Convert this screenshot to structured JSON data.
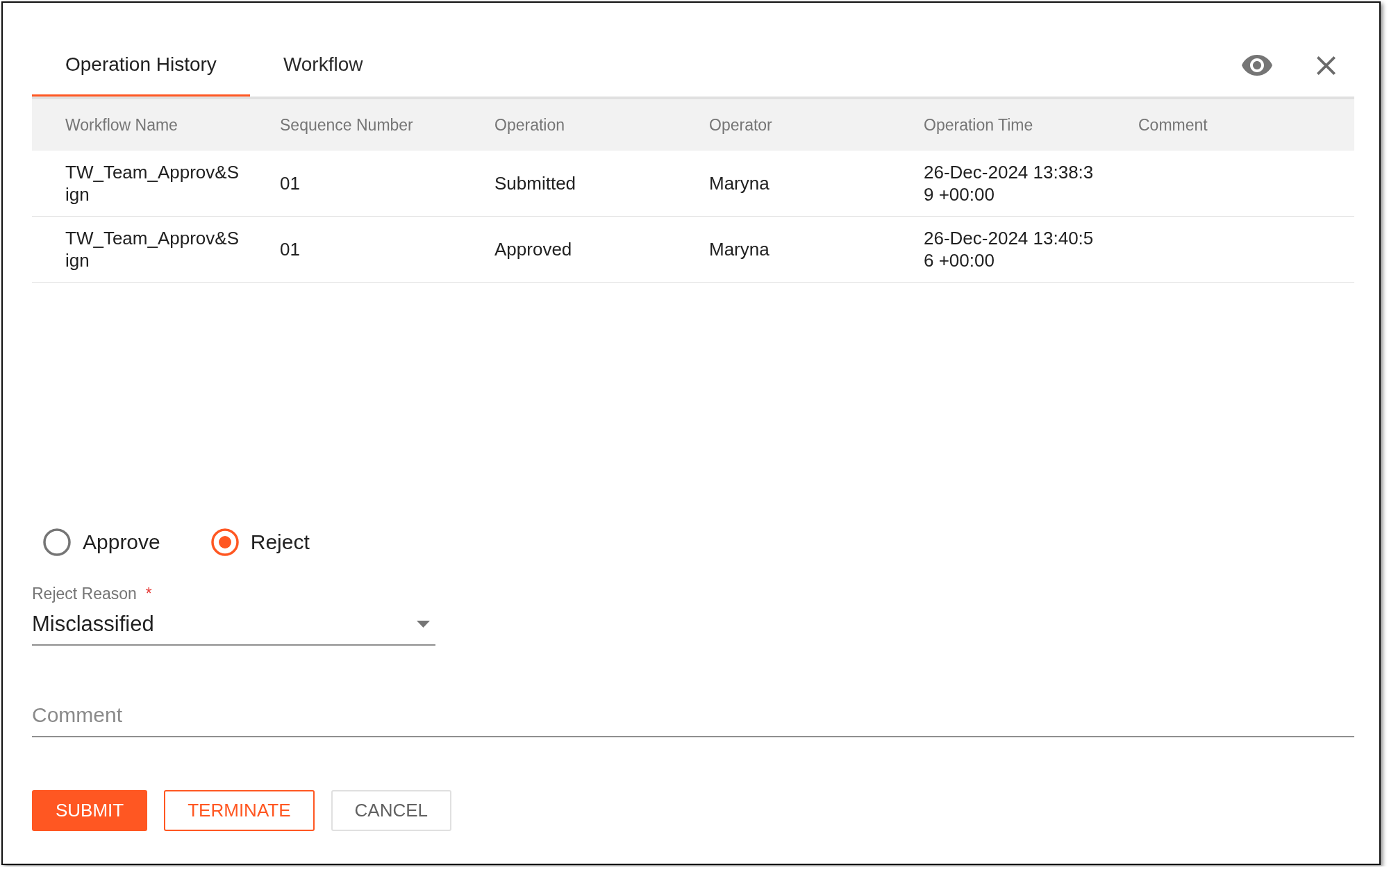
{
  "tabs": [
    {
      "label": "Operation History",
      "selected": true
    },
    {
      "label": "Workflow",
      "selected": false
    }
  ],
  "table": {
    "columns": [
      "Workflow Name",
      "Sequence Number",
      "Operation",
      "Operator",
      "Operation Time",
      "Comment"
    ],
    "rows": [
      {
        "cells": [
          "TW_Team_Approv&Sign",
          "01",
          "Submitted",
          "Maryna",
          "26-Dec-2024 13:38:39 +00:00"
        ]
      },
      {
        "cells": [
          "TW_Team_Approv&Sign",
          "01",
          "Approved",
          "Maryna",
          "26-Dec-2024 13:40:56 +00:00"
        ]
      }
    ]
  },
  "decision": {
    "options": [
      {
        "label": "Approve",
        "selected": false
      },
      {
        "label": "Reject",
        "selected": true
      }
    ]
  },
  "reject_reason": {
    "label": "Reject Reason",
    "required_mark": "*",
    "value": "Misclassified"
  },
  "comment": {
    "placeholder": "Comment"
  },
  "buttons": [
    {
      "label": "SUBMIT",
      "kind": "filled"
    },
    {
      "label": "TERMINATE",
      "kind": "outlined"
    },
    {
      "label": "CANCEL",
      "kind": "plain"
    }
  ]
}
